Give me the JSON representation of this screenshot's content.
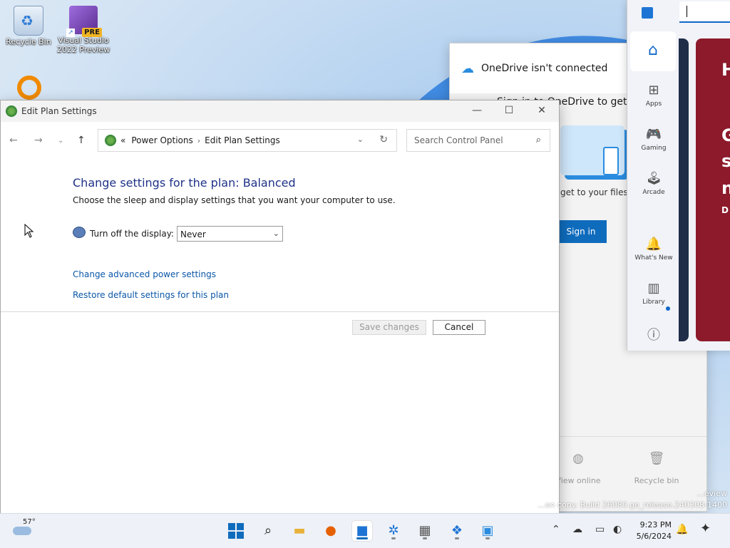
{
  "desktop": {
    "icons": [
      {
        "label": "Recycle Bin"
      },
      {
        "label": "Visual Studio 2022 Preview",
        "badge": "PRE"
      }
    ]
  },
  "onedrive": {
    "title": "OneDrive isn't connected",
    "subtitle": "Sign in to OneDrive to get started",
    "description": "get to your files and...",
    "signin_label": "Sign in",
    "footer": {
      "view_online": "View online",
      "recycle_bin": "Recycle bin"
    }
  },
  "store": {
    "nav": [
      {
        "label": "Apps",
        "icon": "apps-icon"
      },
      {
        "label": "Gaming",
        "icon": "gamepad-icon"
      },
      {
        "label": "Arcade",
        "icon": "joystick-icon"
      },
      {
        "label": "What's New",
        "icon": "bell-icon"
      },
      {
        "label": "Library",
        "icon": "library-icon"
      }
    ],
    "hero_letters": [
      "H",
      "G",
      "s",
      "n",
      "D"
    ]
  },
  "window": {
    "title": "Edit Plan Settings",
    "breadcrumb": {
      "prefix": "«",
      "items": [
        "Power Options",
        "Edit Plan Settings"
      ]
    },
    "search_placeholder": "Search Control Panel",
    "heading": "Change settings for the plan: Balanced",
    "subtext": "Choose the sleep and display settings that you want your computer to use.",
    "display_label": "Turn off the display:",
    "display_value": "Never",
    "links": {
      "advanced": "Change advanced power settings",
      "restore": "Restore default settings for this plan"
    },
    "buttons": {
      "save": "Save changes",
      "cancel": "Cancel"
    }
  },
  "watermark": {
    "line1": "...eview",
    "line2": "...on copy. Build 26080.ge_release.240308-1400"
  },
  "taskbar": {
    "weather_temp": "57°",
    "time": "9:23 PM",
    "date": "5/6/2024"
  },
  "colors": {
    "accent": "#0f6cbd",
    "link": "#0b57a8",
    "heading": "#1e3287",
    "store_card": "#8c1a2b"
  }
}
